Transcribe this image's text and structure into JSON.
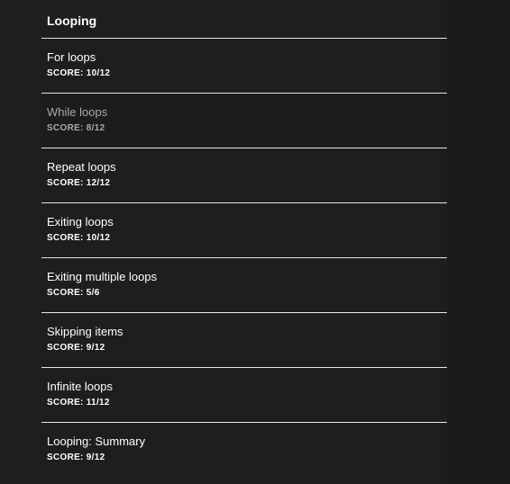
{
  "section": {
    "title": "Looping",
    "items": [
      {
        "title": "For loops",
        "score": "SCORE: 10/12",
        "selected": false
      },
      {
        "title": "While loops",
        "score": "SCORE: 8/12",
        "selected": true
      },
      {
        "title": "Repeat loops",
        "score": "SCORE: 12/12",
        "selected": false
      },
      {
        "title": "Exiting loops",
        "score": "SCORE: 10/12",
        "selected": false
      },
      {
        "title": "Exiting multiple loops",
        "score": "SCORE: 5/6",
        "selected": false
      },
      {
        "title": "Skipping items",
        "score": "SCORE: 9/12",
        "selected": false
      },
      {
        "title": "Infinite loops",
        "score": "SCORE: 11/12",
        "selected": false
      },
      {
        "title": "Looping: Summary",
        "score": "SCORE: 9/12",
        "selected": false
      }
    ]
  },
  "colors": {
    "background": "#1e1e20",
    "divider": "#e6e6e6",
    "text": "#ffffff",
    "muted_text": "#a9a9ab"
  }
}
